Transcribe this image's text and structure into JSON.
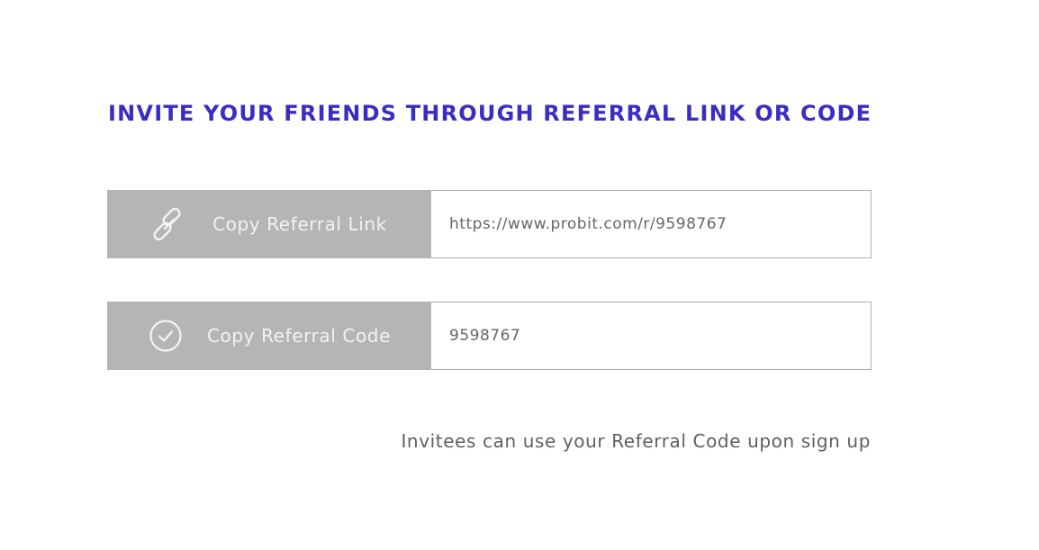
{
  "colors": {
    "heading": "#3b2dc4",
    "button_bg": "#b5b5b5",
    "button_text": "#f2f2f2",
    "value_text": "#666666",
    "note_text": "#5f5f5f",
    "box_border": "#b0b0b0"
  },
  "title": "INVITE YOUR FRIENDS THROUGH REFERRAL LINK OR CODE",
  "referral_link": {
    "button_label": "Copy Referral Link",
    "icon": "link-icon",
    "value": "https://www.probit.com/r/9598767"
  },
  "referral_code": {
    "button_label": "Copy Referral Code",
    "icon": "check-circle-icon",
    "value": "9598767"
  },
  "note": "Invitees can use your Referral Code upon sign up"
}
